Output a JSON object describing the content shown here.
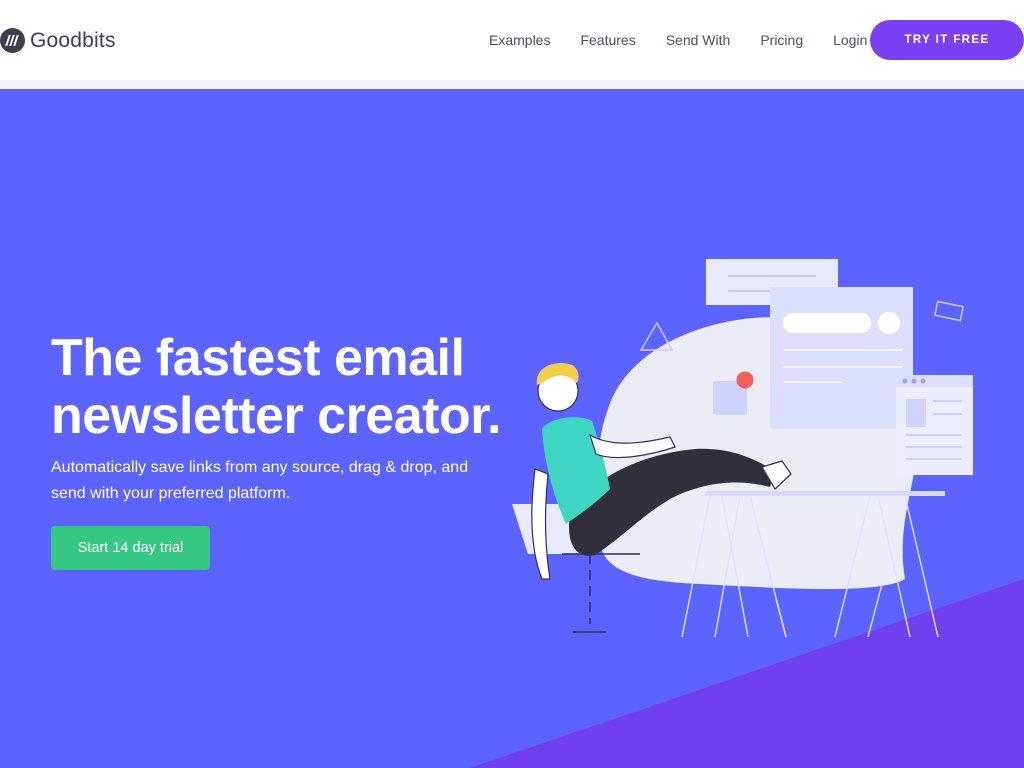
{
  "brand": {
    "name": "Goodbits",
    "logo_icon": "goodbits-logo-icon"
  },
  "nav": {
    "links": [
      {
        "label": "Examples"
      },
      {
        "label": "Features"
      },
      {
        "label": "Send With"
      },
      {
        "label": "Pricing"
      },
      {
        "label": "Login"
      }
    ],
    "cta_label": "TRY IT FREE"
  },
  "hero": {
    "title_line1": "The fastest email",
    "title_line2": "newsletter creator.",
    "subtitle": "Automatically save links from any source, drag & drop, and send with your preferred platform.",
    "cta_label": "Start 14 day trial"
  },
  "colors": {
    "hero_bg": "#5c63fe",
    "accent_purple": "#7a3ff1",
    "cta_green": "#34c882",
    "text_dark": "#3b3f51"
  }
}
